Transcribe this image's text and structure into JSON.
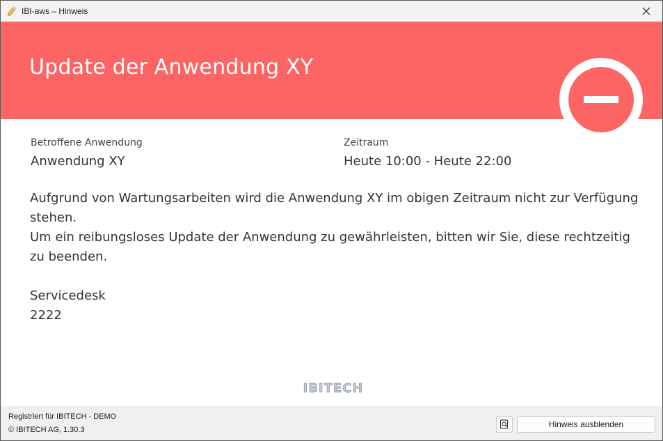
{
  "window": {
    "title": "IBI-aws – Hinweis"
  },
  "banner": {
    "title": "Update der Anwendung XY",
    "color": "#fd6565",
    "status_icon": "minus-circle-icon"
  },
  "fields": {
    "app_label": "Betroffene Anwendung",
    "app_value": "Anwendung XY",
    "period_label": "Zeitraum",
    "period_value": "Heute 10:00 - Heute 22:00"
  },
  "message": {
    "line1": "Aufgrund von Wartungsarbeiten wird die Anwendung XY im obigen Zeitraum nicht zur Verfügung stehen.",
    "line2": "Um ein reibungsloses Update der Anwendung zu gewährleisten, bitten wir Sie, diese rechtzeitig zu beenden."
  },
  "service": {
    "label": "Servicedesk",
    "number": "2222"
  },
  "logo": {
    "text": "IBITECH"
  },
  "footer": {
    "registered": "Registriert für IBITECH - DEMO",
    "copyright": "© IBITECH AG, 1.30.3",
    "hide_button": "Hinweis ausblenden",
    "preview_icon": "magnifier-document-icon"
  }
}
